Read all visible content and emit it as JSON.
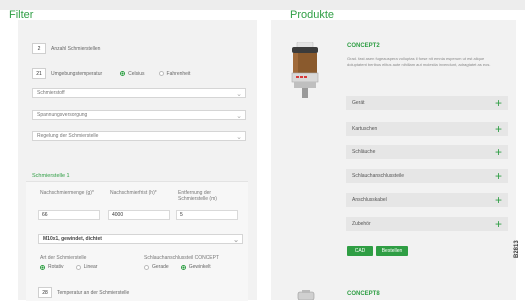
{
  "filter": {
    "title": "Filter",
    "amount": {
      "value": "2",
      "label": "Anzahl Schmierstellen"
    },
    "temperature": {
      "value": "21",
      "label": "Umgebungstemperatur"
    },
    "unit_options": [
      "Celsius",
      "Fahrenheit"
    ],
    "unit_selected": "Celsius",
    "selects": [
      "Schmierstoff",
      "Spannungsversorgung",
      "Regelung der Schmierstelle"
    ]
  },
  "lube_point": {
    "title": "Schmierstelle 1",
    "col1": "Nachschmiermenge (g)*",
    "col2": "Nachschmierfrist (h)*",
    "col3": "Entfernung der Schmierstelle (m)",
    "val1": "66",
    "val2": "4000",
    "val3": "5",
    "thread": "M10x1, gewindet, dichtet",
    "type_label": "Art der Schmierstelle",
    "type_options": [
      "Rotativ",
      "Linear"
    ],
    "type_selected": "Rotativ",
    "connector_label": "Schlauchanschlussteil CONCEPT",
    "connector_options": [
      "Gerade",
      "Gewinkelt"
    ],
    "connector_selected": "Gewinkelt",
    "temp_value": "28",
    "temp_label": "Temperatur an der Schmierstelle"
  },
  "products": {
    "title": "Produkte",
    "product1": {
      "name": "CONCEPT2",
      "description": "Grad. fast asen fugeauspera volluptas il forse nit emnia esperum ut est alique doluptatent beribus elitus aute nihillam aut molestia invendunt, adragtatet as eos."
    },
    "accordion": [
      "Gerät",
      "Kartuschen",
      "Schläuche",
      "Schlauchanschlussteile",
      "Anschlusskabel",
      "Zubehör"
    ],
    "buttons": [
      "CAD",
      "Bestellen"
    ],
    "product2": {
      "name": "CONCEPT8"
    }
  },
  "side_code": "B2813",
  "colors": {
    "accent": "#2f9e44",
    "panel": "#f2f2f2",
    "accordion": "#e6e6e6"
  },
  "icons": {
    "select_chevron": "chevron-down-icon",
    "accordion_expand": "plus-icon"
  }
}
